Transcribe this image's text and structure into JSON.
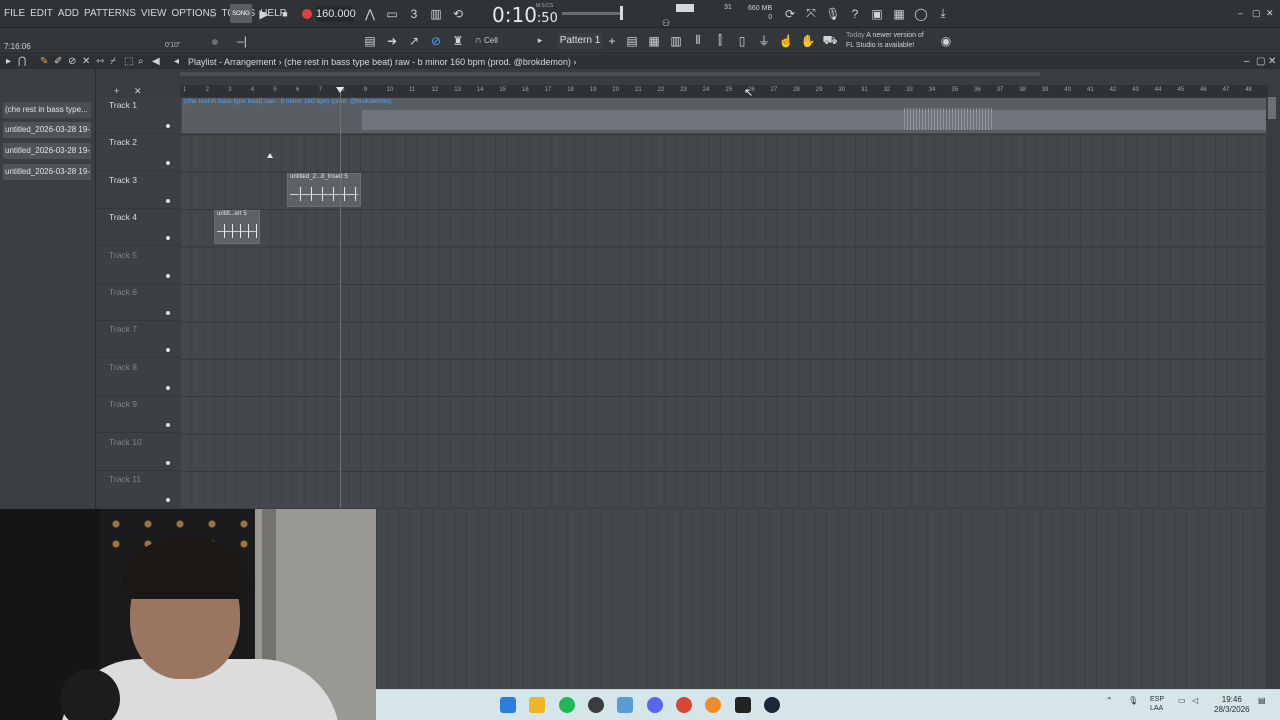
{
  "menu": [
    "FILE",
    "EDIT",
    "ADD",
    "PATTERNS",
    "VIEW",
    "OPTIONS",
    "TOOLS",
    "HELP"
  ],
  "transport": {
    "song_label": "SONG",
    "tempo": "160.000",
    "clock_main": "0:10",
    "clock_sub": ":50",
    "clock_unit": "M:S:CS",
    "cpu_value": "31",
    "mem_value": "660 MB",
    "mem_zero": "0"
  },
  "bar2": {
    "timecode": "7:16:06",
    "small_time": "0'10\"",
    "cell_label": "Cell",
    "pattern_label": "Pattern 1",
    "news_date": "Today",
    "news_text1": "A newer version of",
    "news_text2": "FL Studio is available!"
  },
  "playlist": {
    "title": "Playlist - Arrangement",
    "breadcrumb": "(che rest in bass type beat) raw - b minor 160 bpm (prod. @brokdemon)",
    "arrow": "›"
  },
  "browser_items": [
    "(che rest in bass type...",
    "untitled_2026-03-28 19-...",
    "untitled_2026-03-28 19-...",
    "untitled_2026-03-28 19-..."
  ],
  "ruler_marks": [
    "1",
    "2",
    "3",
    "4",
    "5",
    "6",
    "7",
    "8",
    "9",
    "10",
    "11",
    "12",
    "13",
    "14",
    "15",
    "16",
    "17",
    "18",
    "19",
    "20",
    "21",
    "22",
    "23",
    "24",
    "25",
    "26",
    "27",
    "28",
    "29",
    "30",
    "31",
    "32",
    "33",
    "34",
    "35",
    "36",
    "37",
    "38",
    "39",
    "40",
    "41",
    "42",
    "43",
    "44",
    "45",
    "46",
    "47",
    "48"
  ],
  "tracks": [
    {
      "name": "Track 1",
      "active": true
    },
    {
      "name": "Track 2",
      "active": true
    },
    {
      "name": "Track 3",
      "active": true
    },
    {
      "name": "Track 4",
      "active": true
    },
    {
      "name": "Track 5",
      "active": false
    },
    {
      "name": "Track 6",
      "active": false
    },
    {
      "name": "Track 7",
      "active": false
    },
    {
      "name": "Track 8",
      "active": false
    },
    {
      "name": "Track 9",
      "active": false
    },
    {
      "name": "Track 10",
      "active": false
    },
    {
      "name": "Track 11",
      "active": false
    }
  ],
  "clips": {
    "audio_label": "(che rest in bass type beat) raw - b minor 160 bpm (prod. @brokdemon)",
    "clip3_label": "untitled_2...8_Insert 5",
    "clip4_label": "untitl...ert 5"
  },
  "tray": {
    "lang1": "ESP",
    "lang2": "LAA",
    "time": "19:46",
    "date": "28/3/2026"
  },
  "colors": {
    "accent_blue": "#4aa2ff",
    "record_red": "#e04040",
    "background": "#3a3d40"
  }
}
